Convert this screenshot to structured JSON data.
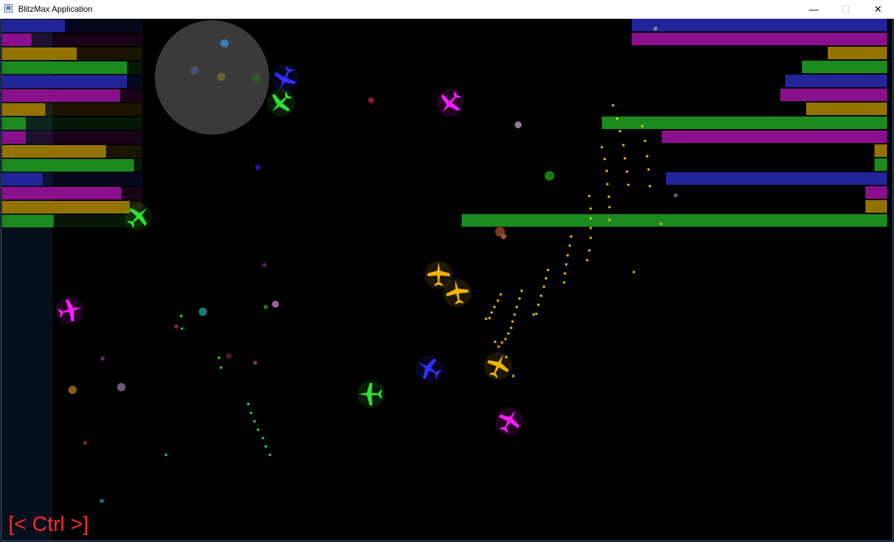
{
  "window": {
    "title": "BlitzMax Application",
    "minimize_glyph": "—",
    "maximize_glyph": "☐",
    "close_glyph": "✕"
  },
  "hud": {
    "ctrl_label": "[< Ctrl >]"
  },
  "colors": {
    "blue": "#22259a",
    "magenta": "#8a0f8c",
    "yellow": "#937200",
    "green": "#1b8a1f",
    "bullet": "#ffd400",
    "green_bullet": "#30ff30",
    "radar": "#3a3a3a",
    "ctrl_text": "#ff2a2a"
  },
  "left_bars": [
    {
      "team": "blue",
      "fraction": 0.45
    },
    {
      "team": "magenta",
      "fraction": 0.21
    },
    {
      "team": "yellow",
      "fraction": 0.53
    },
    {
      "team": "green",
      "fraction": 0.89
    },
    {
      "team": "blue",
      "fraction": 0.89
    },
    {
      "team": "magenta",
      "fraction": 0.84
    },
    {
      "team": "yellow",
      "fraction": 0.31
    },
    {
      "team": "green",
      "fraction": 0.17
    },
    {
      "team": "magenta",
      "fraction": 0.17
    },
    {
      "team": "yellow",
      "fraction": 0.74
    },
    {
      "team": "green",
      "fraction": 0.94
    },
    {
      "team": "blue",
      "fraction": 0.29
    },
    {
      "team": "magenta",
      "fraction": 0.85
    },
    {
      "team": "yellow",
      "fraction": 0.91
    },
    {
      "team": "green",
      "fraction": 0.37
    }
  ],
  "right_bars": [
    {
      "team": "blue",
      "fraction": 0.6
    },
    {
      "team": "magenta",
      "fraction": 0.6
    },
    {
      "team": "yellow",
      "fraction": 0.14
    },
    {
      "team": "green",
      "fraction": 0.2
    },
    {
      "team": "blue",
      "fraction": 0.24
    },
    {
      "team": "magenta",
      "fraction": 0.25
    },
    {
      "team": "yellow",
      "fraction": 0.19
    },
    {
      "team": "green",
      "fraction": 0.67
    },
    {
      "team": "magenta",
      "fraction": 0.53
    },
    {
      "team": "yellow",
      "fraction": 0.03
    },
    {
      "team": "green",
      "fraction": 0.03
    },
    {
      "team": "blue",
      "fraction": 0.52
    },
    {
      "team": "magenta",
      "fraction": 0.05
    },
    {
      "team": "yellow",
      "fraction": 0.05
    },
    {
      "team": "green",
      "fraction": 1.0
    }
  ],
  "planes": [
    {
      "team": "blue",
      "heading": -155
    },
    {
      "team": "green",
      "heading": -135
    },
    {
      "team": "magenta",
      "heading": -140
    },
    {
      "team": "green",
      "heading": 45
    },
    {
      "team": "magenta",
      "heading": 75
    },
    {
      "team": "yellow",
      "heading": 0
    },
    {
      "team": "yellow",
      "heading": -10
    },
    {
      "team": "yellow",
      "heading": 25
    },
    {
      "team": "blue",
      "heading": -60
    },
    {
      "team": "green",
      "heading": -90
    },
    {
      "team": "magenta",
      "heading": 30
    }
  ]
}
